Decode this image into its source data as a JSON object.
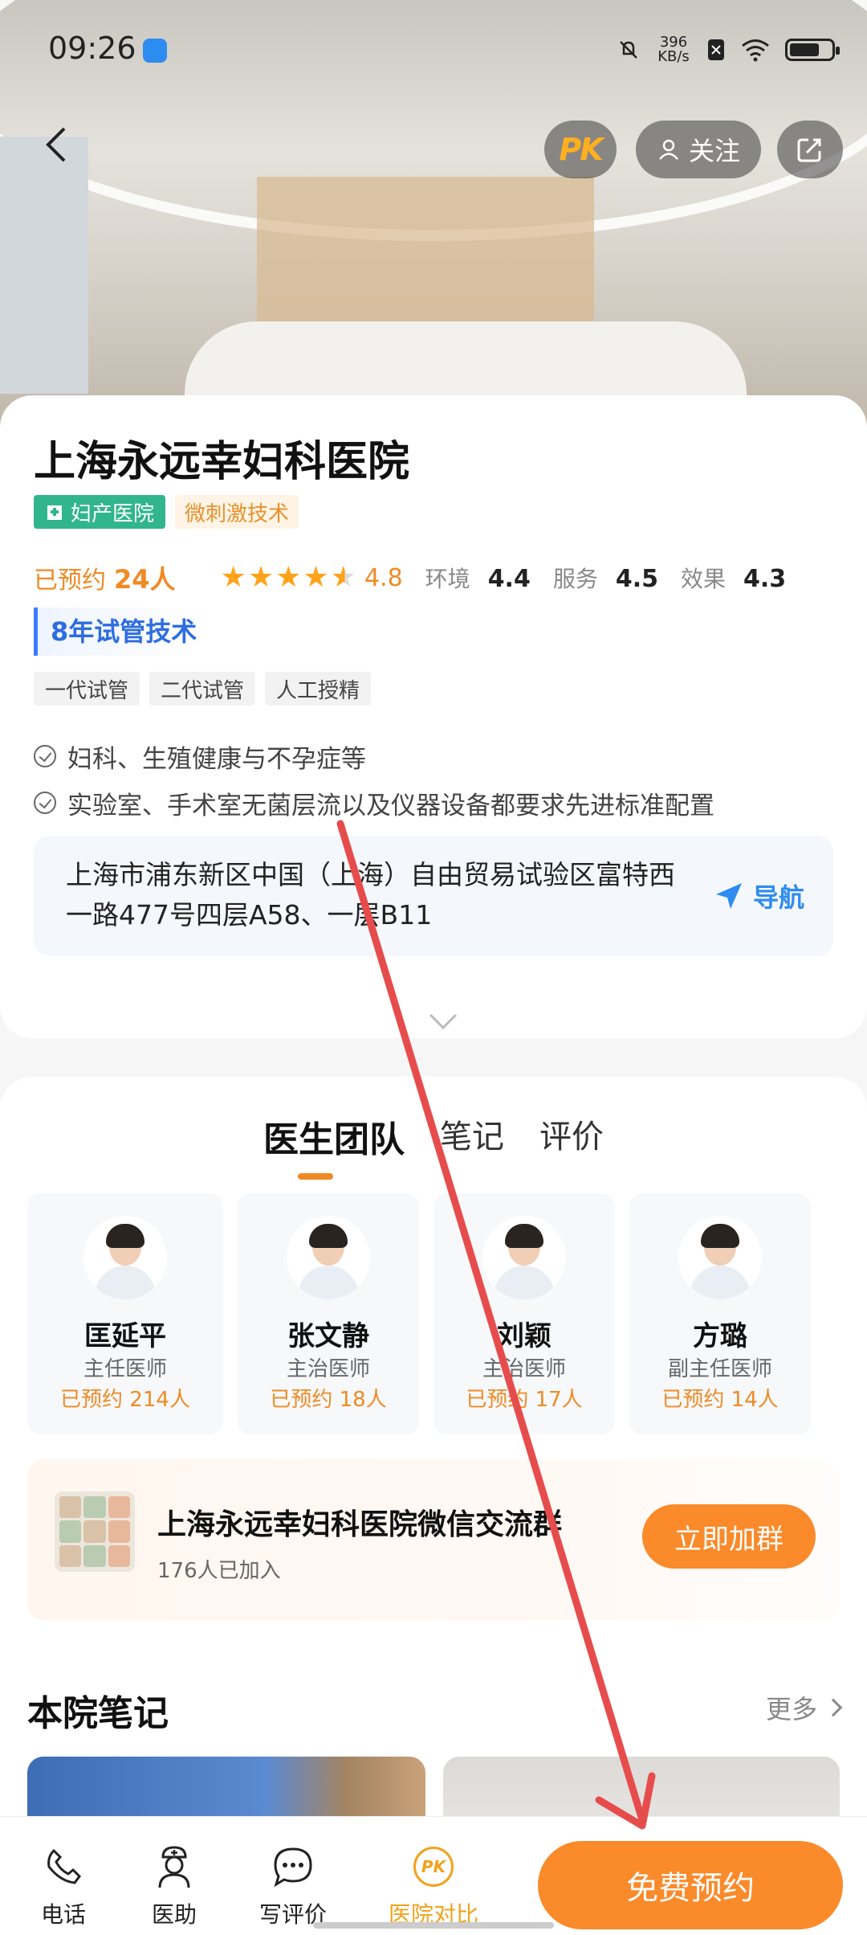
{
  "status_bar": {
    "time": "09:26",
    "net_speed_value": "396",
    "net_speed_unit": "KB/s"
  },
  "header": {
    "pk_label": "PK",
    "follow_label": "关注"
  },
  "hospital": {
    "name": "上海永远幸妇科医院",
    "type_tag": "妇产医院",
    "tech_tag": "微刺激技术",
    "booked_label": "已预约",
    "booked_count": "24人",
    "rating": "4.8",
    "rating_fraction": 0.96,
    "scores": [
      {
        "label": "环境",
        "value": "4.4"
      },
      {
        "label": "服务",
        "value": "4.5"
      },
      {
        "label": "效果",
        "value": "4.3"
      }
    ],
    "ivf_title": "8年试管技术",
    "ivf_tags": [
      "一代试管",
      "二代试管",
      "人工授精"
    ],
    "features": [
      "妇科、生殖健康与不孕症等",
      "实验室、手术室无菌层流以及仪器设备都要求先进标准配置"
    ],
    "address": "上海市浦东新区中国（上海）自由贸易试验区富特西一路477号四层A58、一层B11",
    "nav_label": "导航"
  },
  "tabs": [
    "医生团队",
    "笔记",
    "评价"
  ],
  "doctors": [
    {
      "name": "匡延平",
      "title": "主任医师",
      "booked": "已预约 214人"
    },
    {
      "name": "张文静",
      "title": "主治医师",
      "booked": "已预约 18人"
    },
    {
      "name": "刘颖",
      "title": "主治医师",
      "booked": "已预约 17人"
    },
    {
      "name": "方璐",
      "title": "副主任医师",
      "booked": "已预约 14人"
    }
  ],
  "group": {
    "name": "上海永远幸妇科医院微信交流群",
    "count": "176人已加入",
    "join_label": "立即加群"
  },
  "notes": {
    "title": "本院笔记",
    "more_label": "更多"
  },
  "bottom_bar": {
    "items": [
      {
        "label": "电话",
        "icon": "phone-icon"
      },
      {
        "label": "医助",
        "icon": "nurse-icon"
      },
      {
        "label": "写评价",
        "icon": "chat-icon"
      },
      {
        "label": "医院对比",
        "icon": "pk-icon"
      }
    ],
    "pk_icon_text": "PK",
    "book_label": "免费预约"
  },
  "colors": {
    "accent": "#fa8a2a",
    "rating": "#f08a24",
    "ivf": "#2e6de0",
    "type_tag": "#31b58c",
    "annotation": "#e74c4c"
  }
}
